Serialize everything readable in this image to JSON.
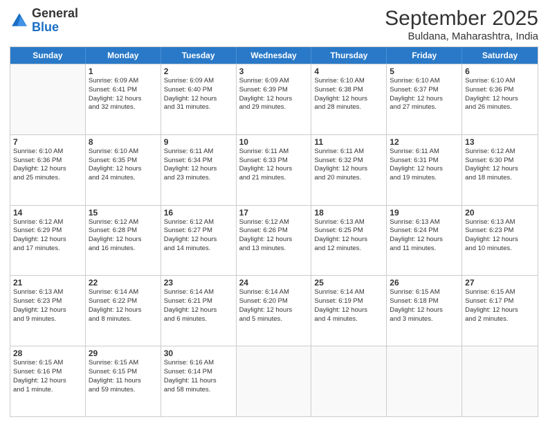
{
  "logo": {
    "general": "General",
    "blue": "Blue"
  },
  "header": {
    "title": "September 2025",
    "subtitle": "Buldana, Maharashtra, India"
  },
  "days": [
    "Sunday",
    "Monday",
    "Tuesday",
    "Wednesday",
    "Thursday",
    "Friday",
    "Saturday"
  ],
  "weeks": [
    [
      {
        "day": "",
        "info": ""
      },
      {
        "day": "1",
        "info": "Sunrise: 6:09 AM\nSunset: 6:41 PM\nDaylight: 12 hours\nand 32 minutes."
      },
      {
        "day": "2",
        "info": "Sunrise: 6:09 AM\nSunset: 6:40 PM\nDaylight: 12 hours\nand 31 minutes."
      },
      {
        "day": "3",
        "info": "Sunrise: 6:09 AM\nSunset: 6:39 PM\nDaylight: 12 hours\nand 29 minutes."
      },
      {
        "day": "4",
        "info": "Sunrise: 6:10 AM\nSunset: 6:38 PM\nDaylight: 12 hours\nand 28 minutes."
      },
      {
        "day": "5",
        "info": "Sunrise: 6:10 AM\nSunset: 6:37 PM\nDaylight: 12 hours\nand 27 minutes."
      },
      {
        "day": "6",
        "info": "Sunrise: 6:10 AM\nSunset: 6:36 PM\nDaylight: 12 hours\nand 26 minutes."
      }
    ],
    [
      {
        "day": "7",
        "info": "Sunrise: 6:10 AM\nSunset: 6:36 PM\nDaylight: 12 hours\nand 25 minutes."
      },
      {
        "day": "8",
        "info": "Sunrise: 6:10 AM\nSunset: 6:35 PM\nDaylight: 12 hours\nand 24 minutes."
      },
      {
        "day": "9",
        "info": "Sunrise: 6:11 AM\nSunset: 6:34 PM\nDaylight: 12 hours\nand 23 minutes."
      },
      {
        "day": "10",
        "info": "Sunrise: 6:11 AM\nSunset: 6:33 PM\nDaylight: 12 hours\nand 21 minutes."
      },
      {
        "day": "11",
        "info": "Sunrise: 6:11 AM\nSunset: 6:32 PM\nDaylight: 12 hours\nand 20 minutes."
      },
      {
        "day": "12",
        "info": "Sunrise: 6:11 AM\nSunset: 6:31 PM\nDaylight: 12 hours\nand 19 minutes."
      },
      {
        "day": "13",
        "info": "Sunrise: 6:12 AM\nSunset: 6:30 PM\nDaylight: 12 hours\nand 18 minutes."
      }
    ],
    [
      {
        "day": "14",
        "info": "Sunrise: 6:12 AM\nSunset: 6:29 PM\nDaylight: 12 hours\nand 17 minutes."
      },
      {
        "day": "15",
        "info": "Sunrise: 6:12 AM\nSunset: 6:28 PM\nDaylight: 12 hours\nand 16 minutes."
      },
      {
        "day": "16",
        "info": "Sunrise: 6:12 AM\nSunset: 6:27 PM\nDaylight: 12 hours\nand 14 minutes."
      },
      {
        "day": "17",
        "info": "Sunrise: 6:12 AM\nSunset: 6:26 PM\nDaylight: 12 hours\nand 13 minutes."
      },
      {
        "day": "18",
        "info": "Sunrise: 6:13 AM\nSunset: 6:25 PM\nDaylight: 12 hours\nand 12 minutes."
      },
      {
        "day": "19",
        "info": "Sunrise: 6:13 AM\nSunset: 6:24 PM\nDaylight: 12 hours\nand 11 minutes."
      },
      {
        "day": "20",
        "info": "Sunrise: 6:13 AM\nSunset: 6:23 PM\nDaylight: 12 hours\nand 10 minutes."
      }
    ],
    [
      {
        "day": "21",
        "info": "Sunrise: 6:13 AM\nSunset: 6:23 PM\nDaylight: 12 hours\nand 9 minutes."
      },
      {
        "day": "22",
        "info": "Sunrise: 6:14 AM\nSunset: 6:22 PM\nDaylight: 12 hours\nand 8 minutes."
      },
      {
        "day": "23",
        "info": "Sunrise: 6:14 AM\nSunset: 6:21 PM\nDaylight: 12 hours\nand 6 minutes."
      },
      {
        "day": "24",
        "info": "Sunrise: 6:14 AM\nSunset: 6:20 PM\nDaylight: 12 hours\nand 5 minutes."
      },
      {
        "day": "25",
        "info": "Sunrise: 6:14 AM\nSunset: 6:19 PM\nDaylight: 12 hours\nand 4 minutes."
      },
      {
        "day": "26",
        "info": "Sunrise: 6:15 AM\nSunset: 6:18 PM\nDaylight: 12 hours\nand 3 minutes."
      },
      {
        "day": "27",
        "info": "Sunrise: 6:15 AM\nSunset: 6:17 PM\nDaylight: 12 hours\nand 2 minutes."
      }
    ],
    [
      {
        "day": "28",
        "info": "Sunrise: 6:15 AM\nSunset: 6:16 PM\nDaylight: 12 hours\nand 1 minute."
      },
      {
        "day": "29",
        "info": "Sunrise: 6:15 AM\nSunset: 6:15 PM\nDaylight: 11 hours\nand 59 minutes."
      },
      {
        "day": "30",
        "info": "Sunrise: 6:16 AM\nSunset: 6:14 PM\nDaylight: 11 hours\nand 58 minutes."
      },
      {
        "day": "",
        "info": ""
      },
      {
        "day": "",
        "info": ""
      },
      {
        "day": "",
        "info": ""
      },
      {
        "day": "",
        "info": ""
      }
    ]
  ]
}
